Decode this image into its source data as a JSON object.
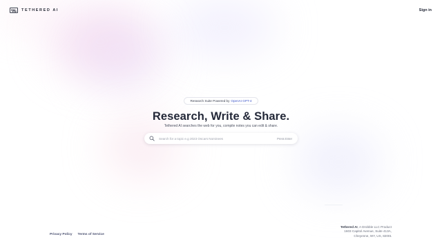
{
  "header": {
    "brand": "TETHERED AI",
    "signin_label": "Sign in"
  },
  "hero": {
    "badge_prefix": "Research Suite Powered by",
    "badge_highlight": "OpenAI GPT-4",
    "headline": "Research, Write & Share.",
    "subline": "Tethered AI searches the web for you, compile notes you can edit & share."
  },
  "search": {
    "placeholder": "Search for a topic e.g 2023 Oscars Nominees",
    "value": "",
    "hint": "Press Enter",
    "icon": "search-icon"
  },
  "footer": {
    "links": [
      "Privacy Policy",
      "Terms of Service"
    ],
    "company_name": "Tethered AI",
    "company_tagline": ", A Drobble LLC Product",
    "address_line1": "1603 Capitol Avenue, Suite 413A,",
    "address_line2": "Cheyenne, WY, US, 82001"
  },
  "colors": {
    "accent": "#3d56c9",
    "text": "#232838",
    "blob_pink": "#eec4e6",
    "blob_lavender": "#e2defa"
  }
}
